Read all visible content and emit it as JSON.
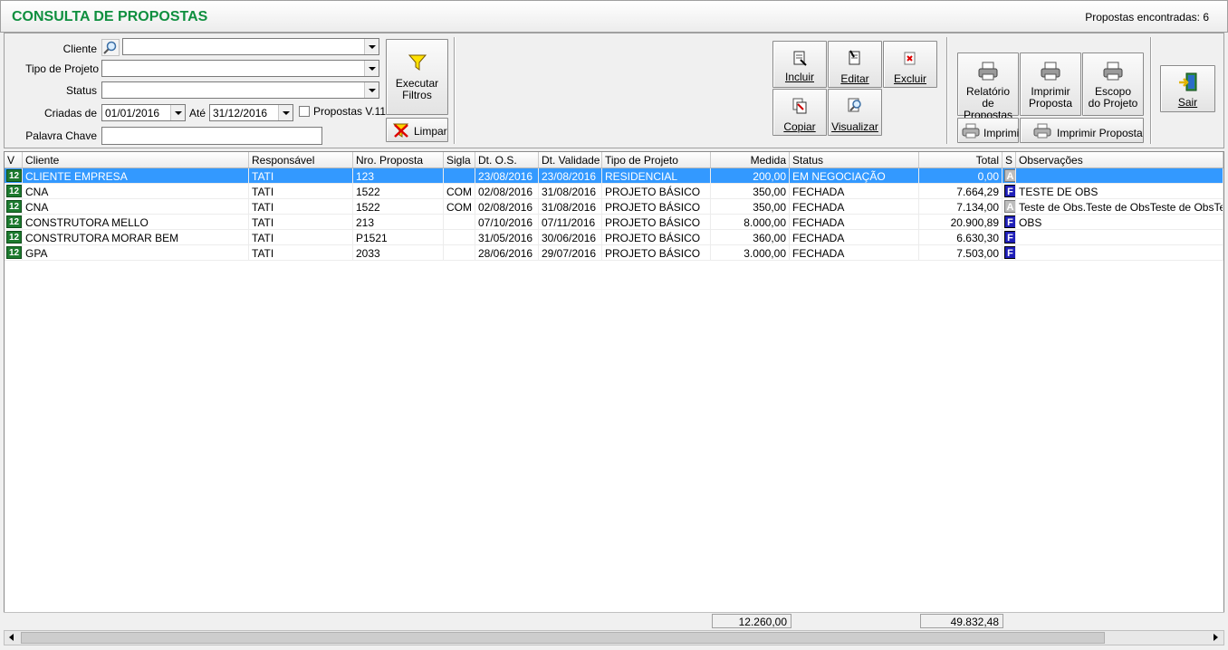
{
  "header": {
    "title": "CONSULTA DE PROPOSTAS",
    "found_text": "Propostas encontradas: 6"
  },
  "filters": {
    "cliente_label": "Cliente",
    "cliente_value": "",
    "tipo_projeto_label": "Tipo de Projeto",
    "tipo_projeto_value": "",
    "status_label": "Status",
    "status_value": "",
    "criadas_de_label": "Criadas de",
    "criadas_de_value": "01/01/2016",
    "ate_label": "Até",
    "ate_value": "31/12/2016",
    "propostas_v11_label": "Propostas V.11",
    "propostas_v11_checked": false,
    "palavra_chave_label": "Palavra Chave",
    "palavra_chave_value": ""
  },
  "buttons": {
    "executar_filtros": "Executar\nFiltros",
    "limpar": "Limpar",
    "incluir": "Incluir",
    "editar": "Editar",
    "excluir": "Excluir",
    "copiar": "Copiar",
    "visualizar": "Visualizar",
    "relatorio_propostas": "Relatório\nde Propostas",
    "imprimir_proposta_top": "Imprimir\nProposta",
    "escopo_projeto": "Escopo\ndo Projeto",
    "imprimir": "Imprimir",
    "imprimir_proposta": "Imprimir Proposta",
    "sair": "Sair"
  },
  "grid": {
    "columns": [
      "V",
      "Cliente",
      "Responsável",
      "Nro. Proposta",
      "Sigla",
      "Dt. O.S.",
      "Dt. Validade",
      "Tipo de Projeto",
      "Medida",
      "Status",
      "Total",
      "S",
      "Observações"
    ],
    "rows": [
      {
        "v": "12",
        "cliente": "CLIENTE EMPRESA",
        "responsavel": "TATI",
        "nro": "123",
        "sigla": "",
        "dt_os": "23/08/2016",
        "dt_validade": "23/08/2016",
        "tipo": "RESIDENCIAL",
        "medida": "200,00",
        "status": "EM NEGOCIAÇÃO",
        "total": "0,00",
        "s": "A",
        "obs": "",
        "selected": true
      },
      {
        "v": "12",
        "cliente": "CNA",
        "responsavel": "TATI",
        "nro": "1522",
        "sigla": "COM",
        "dt_os": "02/08/2016",
        "dt_validade": "31/08/2016",
        "tipo": "PROJETO BÁSICO",
        "medida": "350,00",
        "status": "FECHADA",
        "total": "7.664,29",
        "s": "F",
        "obs": "TESTE DE OBS",
        "selected": false
      },
      {
        "v": "12",
        "cliente": "CNA",
        "responsavel": "TATI",
        "nro": "1522",
        "sigla": "COM",
        "dt_os": "02/08/2016",
        "dt_validade": "31/08/2016",
        "tipo": "PROJETO BÁSICO",
        "medida": "350,00",
        "status": "FECHADA",
        "total": "7.134,00",
        "s": "A",
        "obs": "Teste de Obs.Teste de ObsTeste de ObsTeste d",
        "selected": false
      },
      {
        "v": "12",
        "cliente": "CONSTRUTORA MELLO",
        "responsavel": "TATI",
        "nro": "213",
        "sigla": "",
        "dt_os": "07/10/2016",
        "dt_validade": "07/11/2016",
        "tipo": "PROJETO BÁSICO",
        "medida": "8.000,00",
        "status": "FECHADA",
        "total": "20.900,89",
        "s": "F",
        "obs": "OBS",
        "selected": false
      },
      {
        "v": "12",
        "cliente": "CONSTRUTORA MORAR BEM",
        "responsavel": "TATI",
        "nro": "P1521",
        "sigla": "",
        "dt_os": "31/05/2016",
        "dt_validade": "30/06/2016",
        "tipo": "PROJETO BÁSICO",
        "medida": "360,00",
        "status": "FECHADA",
        "total": "6.630,30",
        "s": "F",
        "obs": "",
        "selected": false
      },
      {
        "v": "12",
        "cliente": "GPA",
        "responsavel": "TATI",
        "nro": "2033",
        "sigla": "",
        "dt_os": "28/06/2016",
        "dt_validade": "29/07/2016",
        "tipo": "PROJETO BÁSICO",
        "medida": "3.000,00",
        "status": "FECHADA",
        "total": "7.503,00",
        "s": "F",
        "obs": "",
        "selected": false
      }
    ],
    "totals": {
      "medida": "12.260,00",
      "total": "49.832,48"
    }
  },
  "icons": {
    "search": "magnifier-icon",
    "filter": "funnel-icon",
    "clear": "clear-filter-icon",
    "printer": "printer-icon",
    "exit": "exit-door-icon"
  },
  "colors": {
    "title": "#0f8f3f",
    "selection": "#3399ff",
    "status_F": "#1f1fb8",
    "status_A": "#bdbdbd",
    "v_badge": "#1d7a2f"
  }
}
